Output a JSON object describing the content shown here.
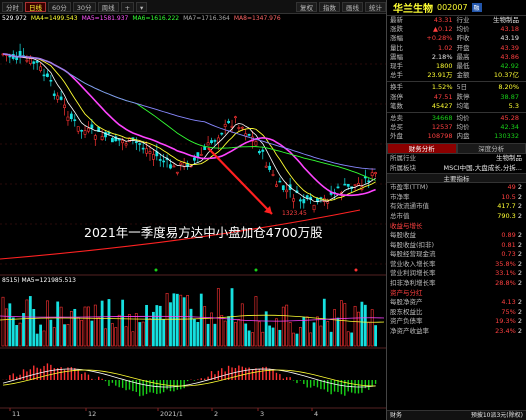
{
  "toolbar": {
    "periods": [
      "分时",
      "日线",
      "60分",
      "30分",
      "周线"
    ],
    "active_period": "日线",
    "zoom": "+",
    "right": [
      "复权",
      "指数",
      "画线",
      "统计"
    ]
  },
  "ma_legend": [
    {
      "text": "529.972",
      "color": "#ffffff"
    },
    {
      "text": "MA4=1499.543",
      "color": "#ffff33"
    },
    {
      "text": "MA5=1581.937",
      "color": "#ff55ff"
    },
    {
      "text": "MA6=1616.222",
      "color": "#33ff33"
    },
    {
      "text": "MA7=1716.364",
      "color": "#aaaaaa"
    },
    {
      "text": "MA8=1347.976",
      "color": "#ff6666"
    }
  ],
  "volume_legend": "8515) MA5=121985.513",
  "annotation": {
    "text": "2021年一季度易方达中小盘加仓4700万股",
    "low_price": "1323.45"
  },
  "x_axis": [
    "11",
    "12",
    "2021/1",
    "2",
    "3",
    "4"
  ],
  "panel": {
    "name": "华兰生物",
    "code": "002007",
    "badge": "融",
    "quote_rows": [
      [
        {
          "l": "最新",
          "v": "43.31",
          "c": "red"
        },
        {
          "l": "行业",
          "v": "生物制品",
          "c": "white"
        }
      ],
      [
        {
          "l": "涨跌",
          "v": "▲0.12",
          "c": "red"
        },
        {
          "l": "均价",
          "v": "43.18",
          "c": "red"
        }
      ],
      [
        {
          "l": "涨幅",
          "v": "+0.28%",
          "c": "red"
        },
        {
          "l": "昨收",
          "v": "43.19",
          "c": "white"
        }
      ],
      [
        {
          "l": "量比",
          "v": "1.02",
          "c": "red"
        },
        {
          "l": "开盘",
          "v": "43.39",
          "c": "red"
        }
      ],
      [
        {
          "l": "震幅",
          "v": "2.18%",
          "c": "white"
        },
        {
          "l": "最高",
          "v": "43.86",
          "c": "red"
        }
      ],
      [
        {
          "l": "现手",
          "v": "1800",
          "c": "yellow"
        },
        {
          "l": "最低",
          "v": "42.92",
          "c": "green"
        }
      ],
      [
        {
          "l": "总手",
          "v": "23.91万",
          "c": "yellow"
        },
        {
          "l": "金额",
          "v": "10.37亿",
          "c": "yellow"
        }
      ],
      [
        {
          "l": "换手",
          "v": "1.52%",
          "c": "yellow"
        },
        {
          "l": "5日",
          "v": "8.20%",
          "c": "yellow"
        }
      ],
      [
        {
          "l": "涨停",
          "v": "47.51",
          "c": "red"
        },
        {
          "l": "跌停",
          "v": "38.87",
          "c": "green"
        }
      ],
      [
        {
          "l": "笔数",
          "v": "45427",
          "c": "yellow"
        },
        {
          "l": "均笔",
          "v": "5.3",
          "c": "yellow"
        }
      ],
      [
        {
          "l": "总卖",
          "v": "34668",
          "c": "green"
        },
        {
          "l": "均价",
          "v": "45.28",
          "c": "red"
        }
      ],
      [
        {
          "l": "总买",
          "v": "12537",
          "c": "red"
        },
        {
          "l": "均价",
          "v": "42.34",
          "c": "green"
        }
      ],
      [
        {
          "l": "外盘",
          "v": "108798",
          "c": "red"
        },
        {
          "l": "内盘",
          "v": "130332",
          "c": "green"
        }
      ]
    ],
    "tabs": [
      "财务分析",
      "深度分析"
    ],
    "industry_rows": [
      {
        "l": "所属行业",
        "v": "生物制品",
        "c": "white"
      },
      {
        "l": "所属板块",
        "v": "MSCI中国,大盘成长,分拆...",
        "c": "white"
      }
    ],
    "main_section": "主要指标",
    "main_rows": [
      {
        "l": "市盈率(TTM)",
        "v": "49",
        "c": "red",
        "n": "2"
      },
      {
        "l": "市净率",
        "v": "10.5",
        "c": "red",
        "n": "2"
      },
      {
        "l": "有效流通市值",
        "v": "417.7",
        "c": "yellow",
        "n": "2"
      },
      {
        "l": "总市值",
        "v": "790.3",
        "c": "yellow",
        "n": "2"
      }
    ],
    "sec_income": "收益与增长",
    "income_rows": [
      {
        "l": "每股收益",
        "v": "0.89",
        "c": "red",
        "n": "2"
      },
      {
        "l": "每股收益(扣非)",
        "v": "0.81",
        "c": "red",
        "n": "2"
      },
      {
        "l": "每股经营现金流",
        "v": "0.73",
        "c": "red",
        "n": "2"
      },
      {
        "l": "营业收入增长率",
        "v": "35.8%",
        "c": "red",
        "n": "2"
      },
      {
        "l": "营业利润增长率",
        "v": "33.1%",
        "c": "red",
        "n": "2"
      },
      {
        "l": "扣非净利增长率",
        "v": "28.8%",
        "c": "red",
        "n": "2"
      }
    ],
    "sec_assets": "资产与分红",
    "asset_rows": [
      {
        "l": "每股净资产",
        "v": "4.13",
        "c": "red",
        "n": "2"
      },
      {
        "l": "股东权益比",
        "v": "75%",
        "c": "red",
        "n": "2"
      },
      {
        "l": "资产负债率",
        "v": "19.3%",
        "c": "red",
        "n": "2"
      },
      {
        "l": "净资产收益率",
        "v": "23.4%",
        "c": "red",
        "n": "2"
      },
      {
        "l": "资产负债率",
        "v": "",
        "c": "red",
        "n": ""
      }
    ],
    "footer_left": "财务",
    "footer_right": "预披10派3元(除权)"
  }
}
